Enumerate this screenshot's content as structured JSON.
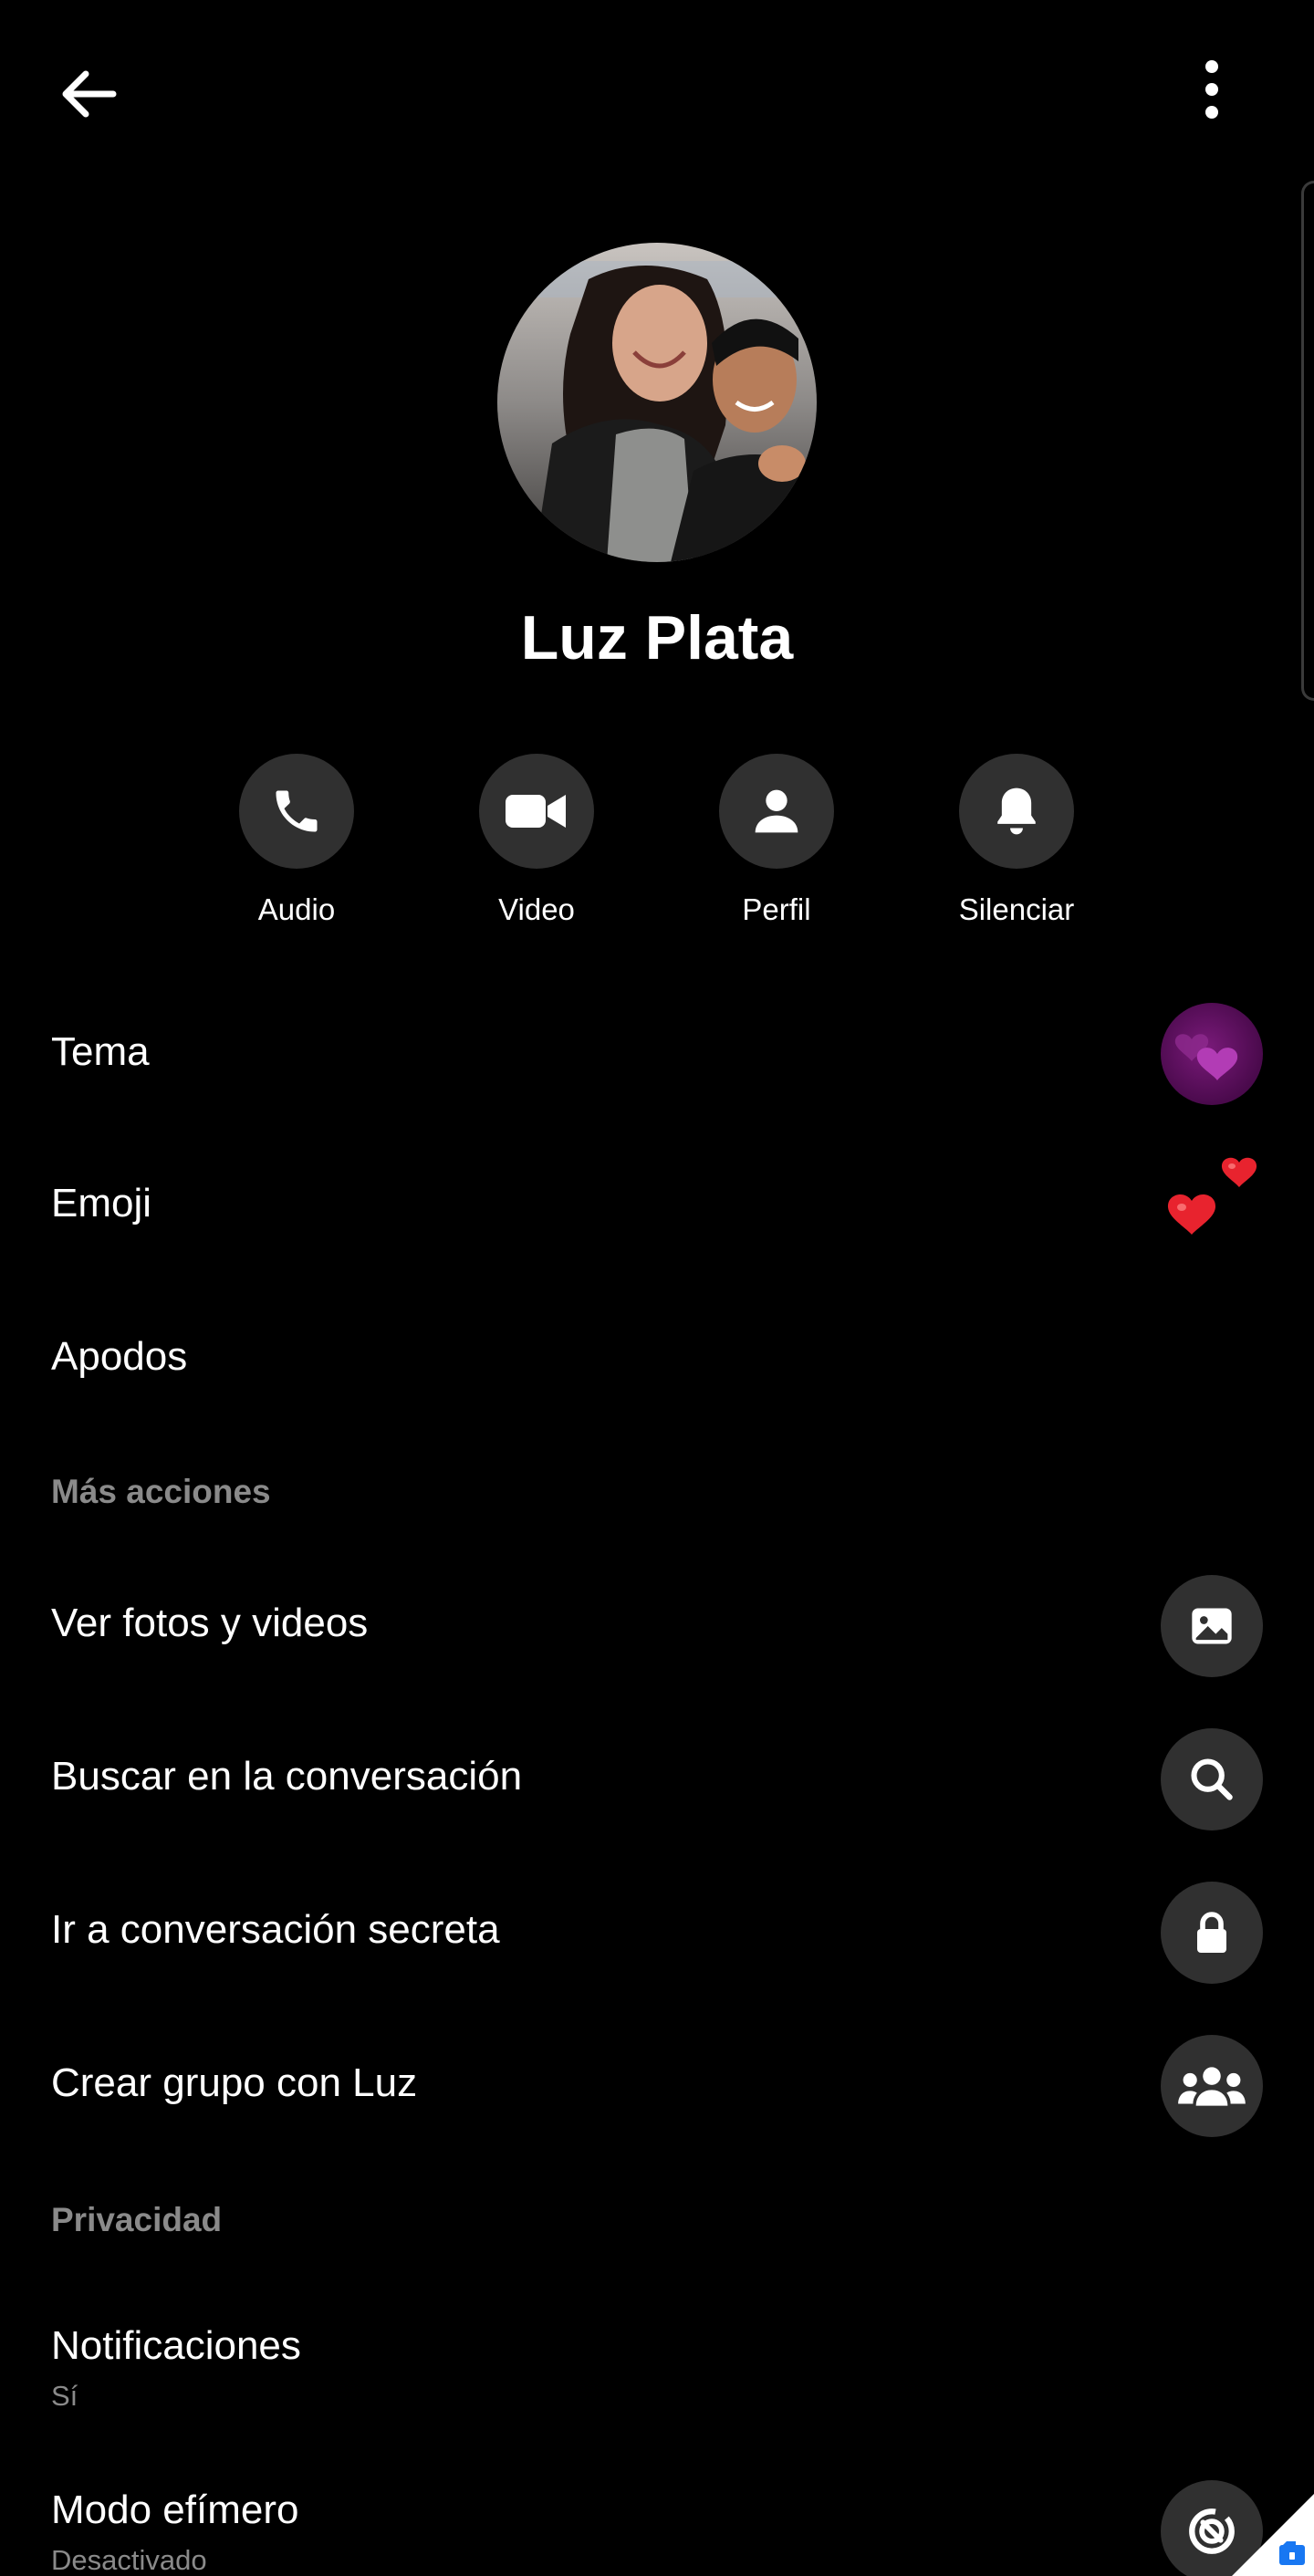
{
  "header": {
    "back_icon": "arrow-left-icon",
    "more_icon": "vertical-dots-icon"
  },
  "profile": {
    "name": "Luz Plata"
  },
  "actions": [
    {
      "label": "Audio",
      "icon": "phone-icon"
    },
    {
      "label": "Video",
      "icon": "video-camera-icon"
    },
    {
      "label": "Perfil",
      "icon": "person-icon"
    },
    {
      "label": "Silenciar",
      "icon": "bell-icon"
    }
  ],
  "customization": {
    "theme_label": "Tema",
    "emoji_label": "Emoji",
    "nicknames_label": "Apodos"
  },
  "more_actions": {
    "header": "Más acciones",
    "items": [
      {
        "label": "Ver fotos y videos",
        "icon": "image-icon"
      },
      {
        "label": "Buscar en la conversación",
        "icon": "search-icon"
      },
      {
        "label": "Ir a conversación secreta",
        "icon": "lock-icon"
      },
      {
        "label": "Crear grupo con Luz",
        "icon": "group-icon"
      }
    ]
  },
  "privacy": {
    "header": "Privacidad",
    "notifications_label": "Notificaciones",
    "notifications_value": "Sí",
    "vanish_label": "Modo efímero",
    "vanish_value": "Desactivado",
    "vanish_icon": "vanish-mode-icon"
  },
  "colors": {
    "background": "#000000",
    "circle_bg": "#303030",
    "muted_text": "#8a8a8a",
    "theme_purple": "#7a1a7a",
    "heart_red": "#e8232e"
  }
}
